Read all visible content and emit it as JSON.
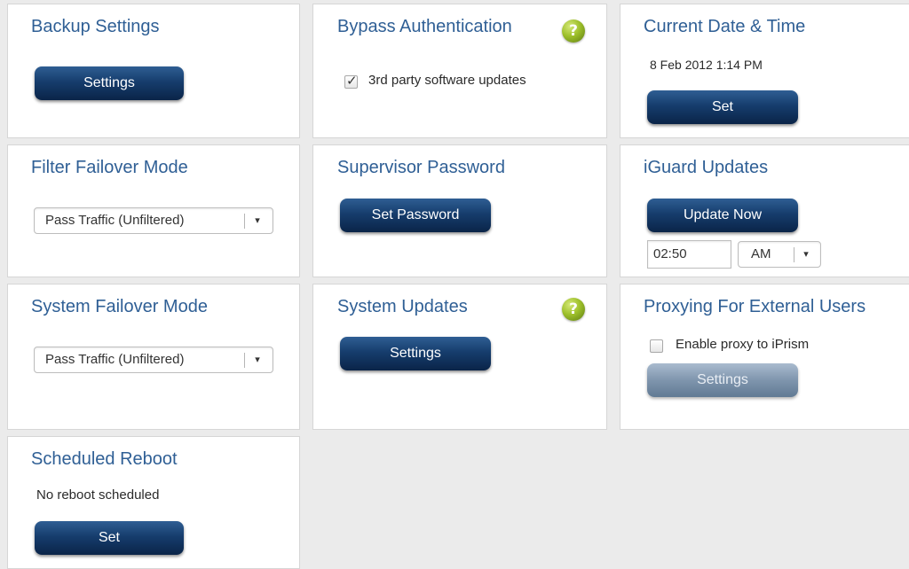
{
  "backup": {
    "title": "Backup Settings",
    "button": "Settings"
  },
  "bypass": {
    "title": "Bypass Authentication",
    "help_icon": "?",
    "checkbox_label": "3rd party software updates",
    "checked": true
  },
  "datetime": {
    "title": "Current Date & Time",
    "value": "8 Feb 2012 1:14 PM",
    "button": "Set"
  },
  "filter_failover": {
    "title": "Filter Failover Mode",
    "selected": "Pass Traffic (Unfiltered)"
  },
  "supervisor": {
    "title": "Supervisor Password",
    "button": "Set Password"
  },
  "iguard": {
    "title": "iGuard Updates",
    "button": "Update Now",
    "time": "02:50",
    "ampm": "AM"
  },
  "system_failover": {
    "title": "System Failover Mode",
    "selected": "Pass Traffic (Unfiltered)"
  },
  "system_updates": {
    "title": "System Updates",
    "help_icon": "?",
    "button": "Settings"
  },
  "proxy": {
    "title": "Proxying For External Users",
    "checkbox_label": "Enable proxy to iPrism",
    "checked": false,
    "button": "Settings"
  },
  "reboot": {
    "title": "Scheduled Reboot",
    "status": "No reboot scheduled",
    "button": "Set"
  },
  "icons": {
    "dropdown": "▾",
    "checkmark": "✓"
  },
  "colors": {
    "title": "#2f5f95",
    "button_dark": "#0a2448",
    "help_green": "#9ec02b",
    "background": "#ebebeb"
  }
}
